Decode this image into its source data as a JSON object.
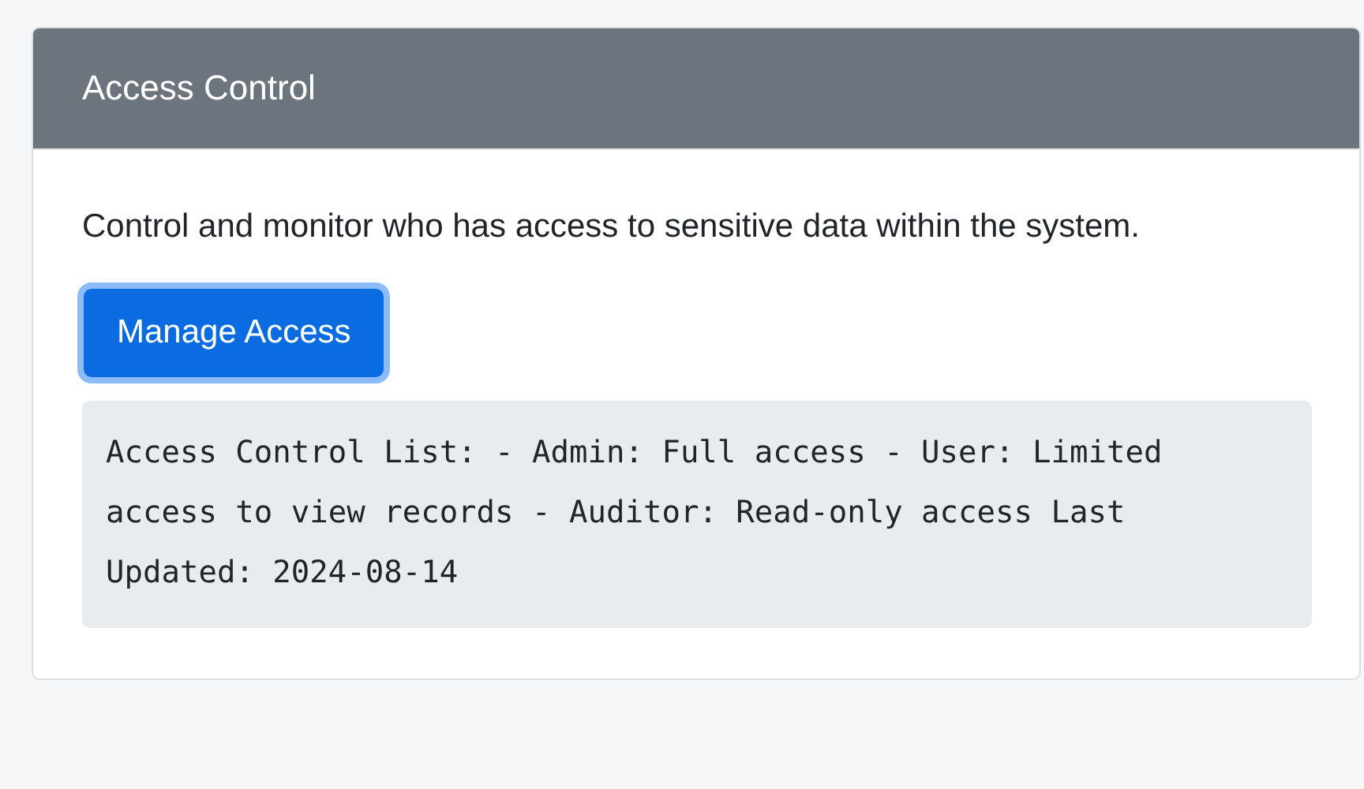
{
  "card": {
    "title": "Access Control",
    "description": "Control and monitor who has access to sensitive data within the system.",
    "button": {
      "label": "Manage Access",
      "focused": true
    },
    "code_block": "Access Control List: - Admin: Full access - User: Limited access to view records - Auditor: Read-only access Last Updated: 2024-08-14"
  }
}
